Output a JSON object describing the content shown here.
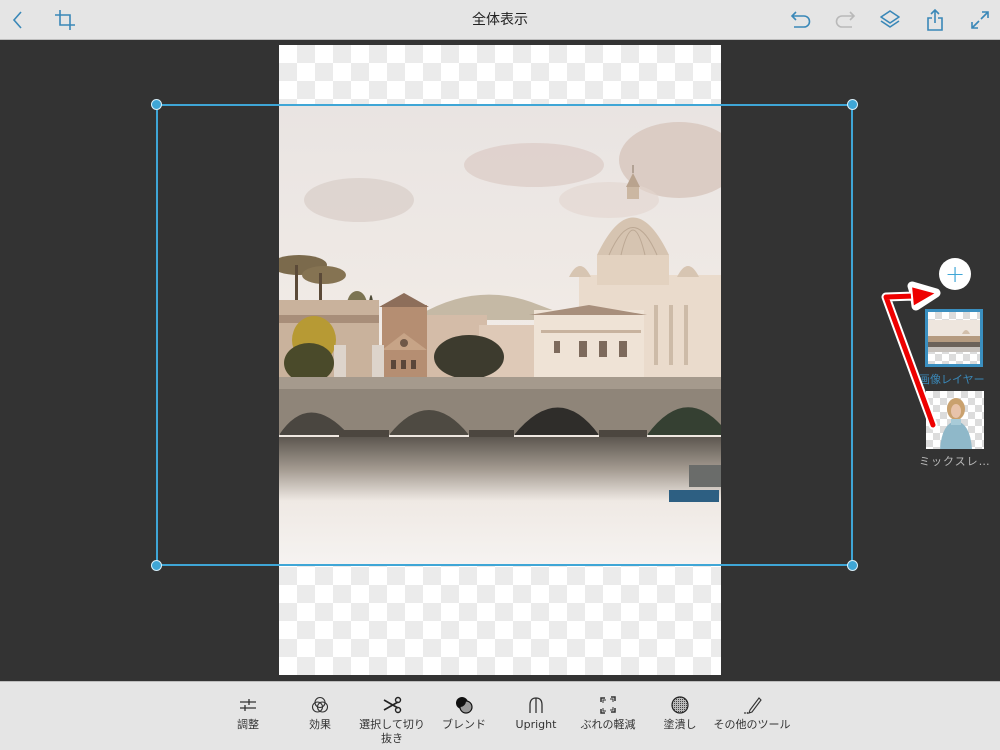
{
  "topbar": {
    "title": "全体表示",
    "icons": {
      "back": "chevron-left-icon",
      "crop": "crop-icon",
      "undo": "undo-icon",
      "redo": "redo-icon",
      "layers": "layers-icon",
      "share": "share-icon",
      "fullscreen": "expand-icon"
    }
  },
  "colors": {
    "accent": "#3fa6d6",
    "toolbar_bg": "#e5e5e5",
    "workspace_bg": "#333333",
    "annotation_arrow": "#ff0000"
  },
  "canvas": {
    "image_description": "Rome: St. Peter's Basilica dome behind Ponte Sant'Angelo over the Tiber at sunset",
    "selection_active": true
  },
  "layers": {
    "add_label": "+",
    "items": [
      {
        "label": "画像レイヤー",
        "selected": true,
        "thumbnail": "rome-cityscape"
      },
      {
        "label": "ミックスレ…",
        "selected": false,
        "thumbnail": "woman-in-blue-sweater"
      }
    ]
  },
  "toolbar": {
    "tools": [
      {
        "label": "調整",
        "icon": "sliders-icon"
      },
      {
        "label": "効果",
        "icon": "effects-circles-icon"
      },
      {
        "label": "選択して切り抜き",
        "icon": "scissors-icon"
      },
      {
        "label": "ブレンド",
        "icon": "blend-icon"
      },
      {
        "label": "Upright",
        "icon": "upright-arrow-icon"
      },
      {
        "label": "ぶれの軽減",
        "icon": "shake-reduction-icon"
      },
      {
        "label": "塗潰し",
        "icon": "fill-icon"
      },
      {
        "label": "その他のツール",
        "icon": "pencil-icon"
      }
    ]
  }
}
